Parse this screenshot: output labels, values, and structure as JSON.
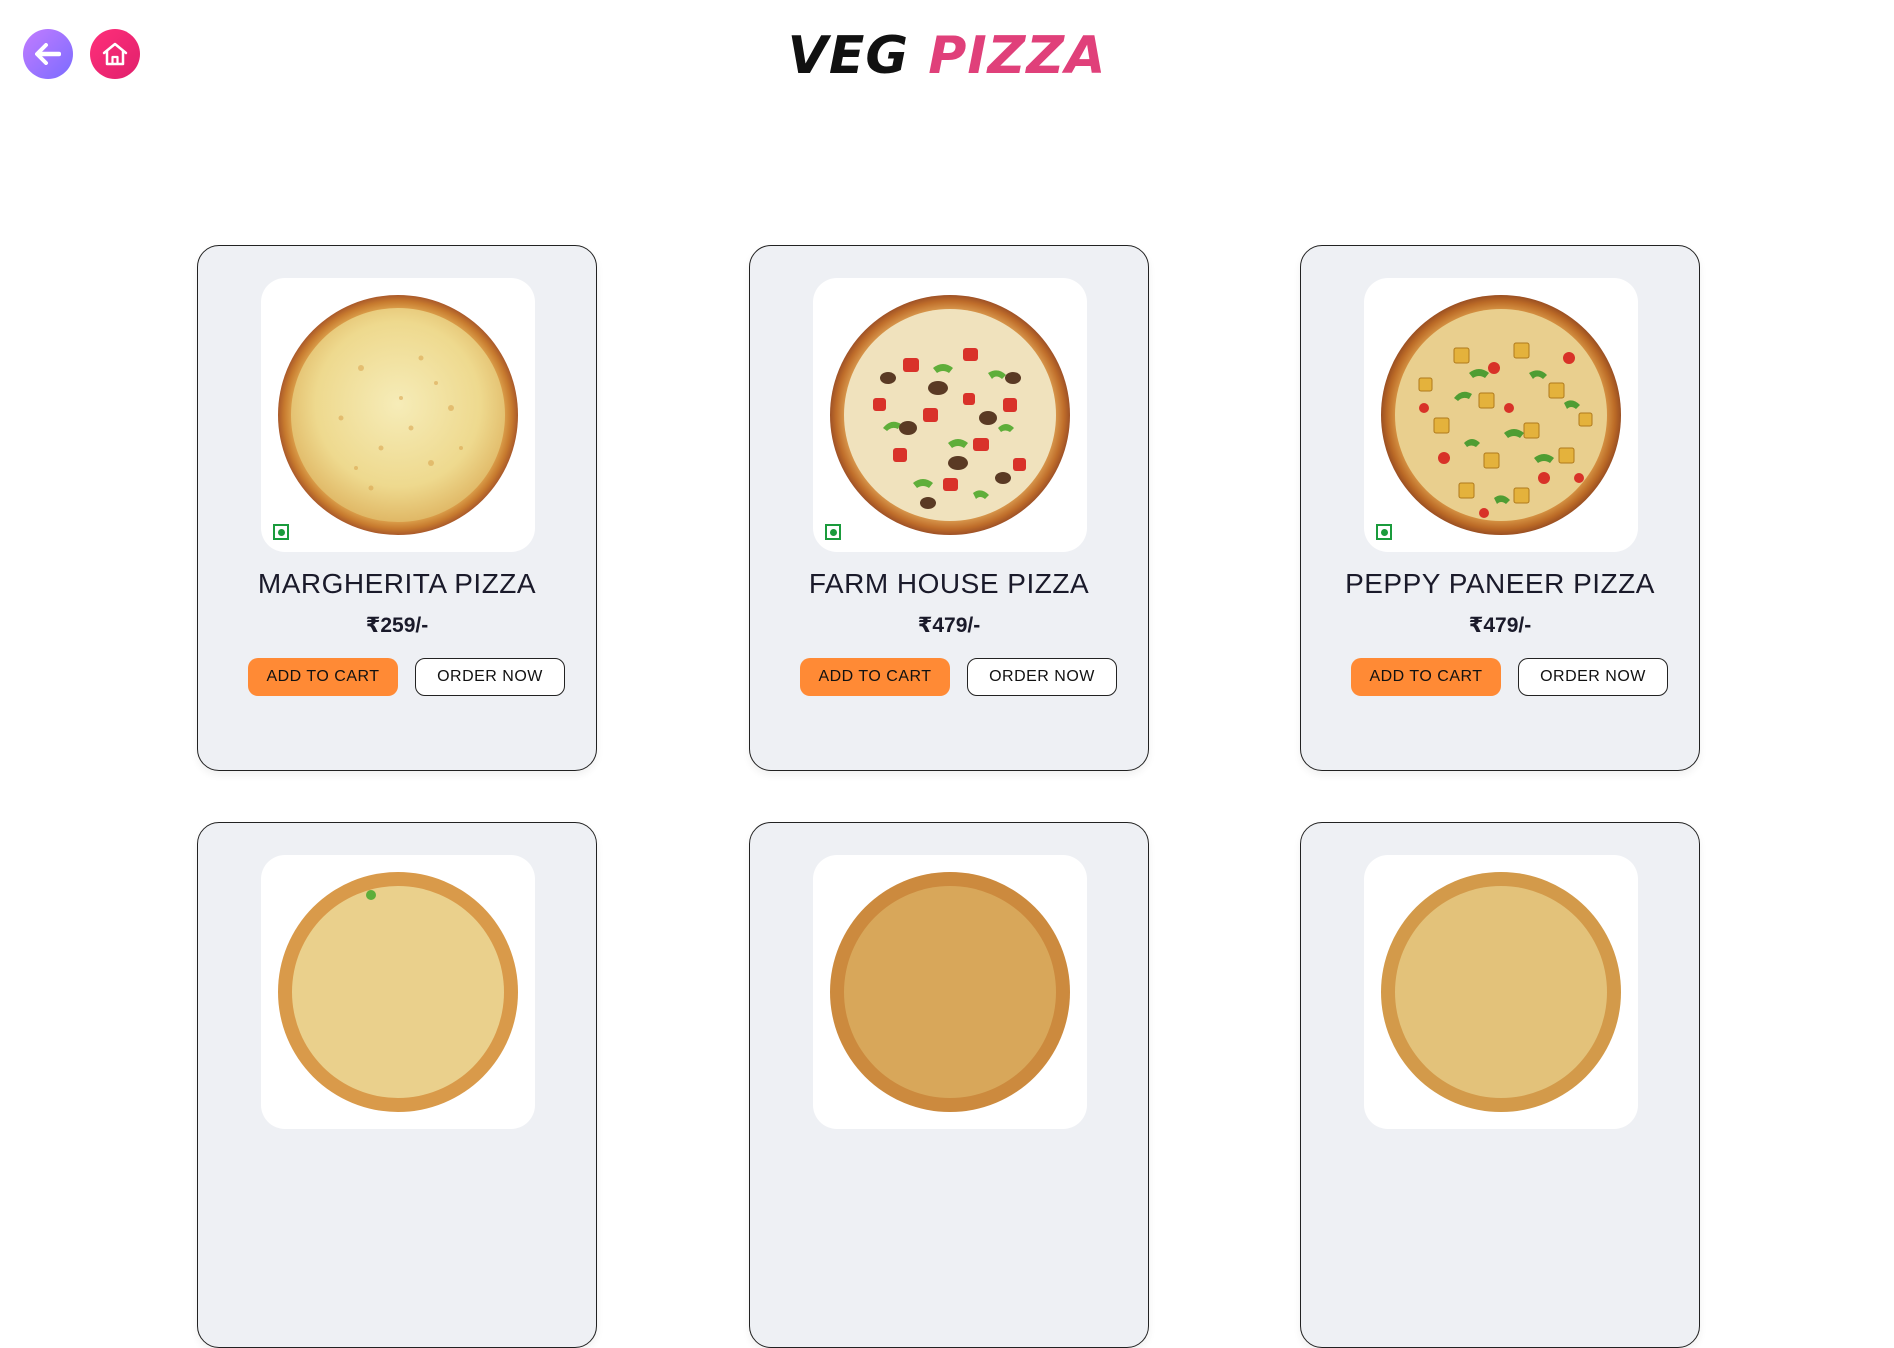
{
  "header": {
    "title_word_1": "VEG",
    "title_word_2": "PIZZA",
    "title_colors": {
      "word_1": "#111111",
      "word_2": "#e0407a"
    }
  },
  "nav": {
    "back_icon": "arrow-left-icon",
    "home_icon": "home-icon"
  },
  "colors": {
    "card_bg": "#eef0f4",
    "add_to_cart_bg": "#ff8a35",
    "veg_mark": "#1a9b3c"
  },
  "products": [
    {
      "name": "MARGHERITA PIZZA",
      "price": "₹259/-",
      "add_label": "ADD TO CART",
      "order_label": "ORDER NOW"
    },
    {
      "name": "FARM HOUSE PIZZA",
      "price": "₹479/-",
      "add_label": "ADD TO CART",
      "order_label": "ORDER NOW"
    },
    {
      "name": "PEPPY PANEER PIZZA",
      "price": "₹479/-",
      "add_label": "ADD TO CART",
      "order_label": "ORDER NOW"
    }
  ]
}
